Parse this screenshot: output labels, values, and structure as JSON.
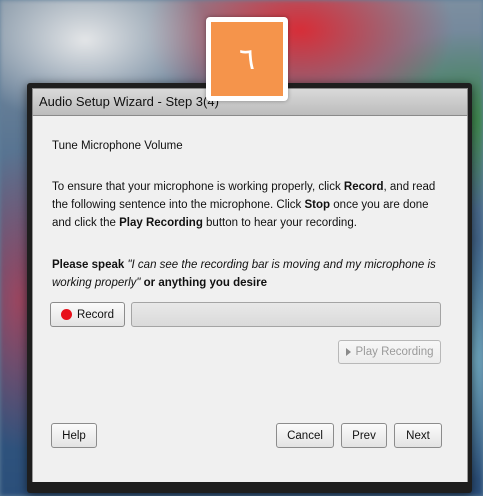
{
  "step_badge": {
    "label": "٦",
    "color": "#f5944b"
  },
  "dialog": {
    "title": "Audio Setup Wizard - Step 3(4)",
    "heading": "Tune Microphone Volume",
    "instructions": {
      "part1": "To ensure that your microphone is working properly, click ",
      "record_word": "Record",
      "part2": ", and read the following sentence into the microphone. Click ",
      "stop_word": "Stop",
      "part3": " once you are done and click the ",
      "play_word": "Play Recording",
      "part4": " button to hear your recording."
    },
    "speak": {
      "lead": "Please speak ",
      "sentence": "\"I can see the recording bar is moving and my microphone is working properly\"",
      "tail": " or anything you desire"
    },
    "record_button": {
      "label": "Record",
      "icon": "record-dot-icon",
      "icon_color": "#e8101a"
    },
    "play_recording_button": {
      "label": "Play Recording",
      "icon": "play-triangle-icon",
      "enabled": false
    },
    "footer": {
      "help": "Help",
      "cancel": "Cancel",
      "prev": "Prev",
      "next": "Next"
    }
  }
}
